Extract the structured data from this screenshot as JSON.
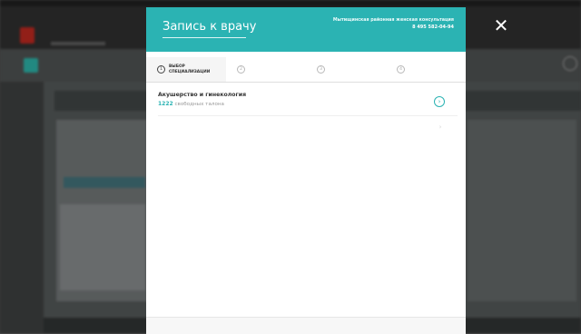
{
  "modal": {
    "title": "Запись к врачу",
    "clinic": {
      "name": "Мытищинская районная женская консультация",
      "phone": "8 495 582-04-94"
    },
    "close_icon": "close-icon",
    "steps": [
      {
        "num": "1",
        "label": "Выбор специализации",
        "active": true
      },
      {
        "num": "2",
        "label": "",
        "active": false
      },
      {
        "num": "3",
        "label": "",
        "active": false
      },
      {
        "num": "4",
        "label": "",
        "active": false
      }
    ],
    "specialties": [
      {
        "name": "Акушерство и гинекология",
        "count": "1222",
        "available_text": "свободных талона"
      },
      {
        "name": "",
        "available_text": ""
      }
    ],
    "footer_link": ""
  },
  "colors": {
    "accent": "#2bb3b3",
    "background_dim": "#4a4a4a"
  }
}
